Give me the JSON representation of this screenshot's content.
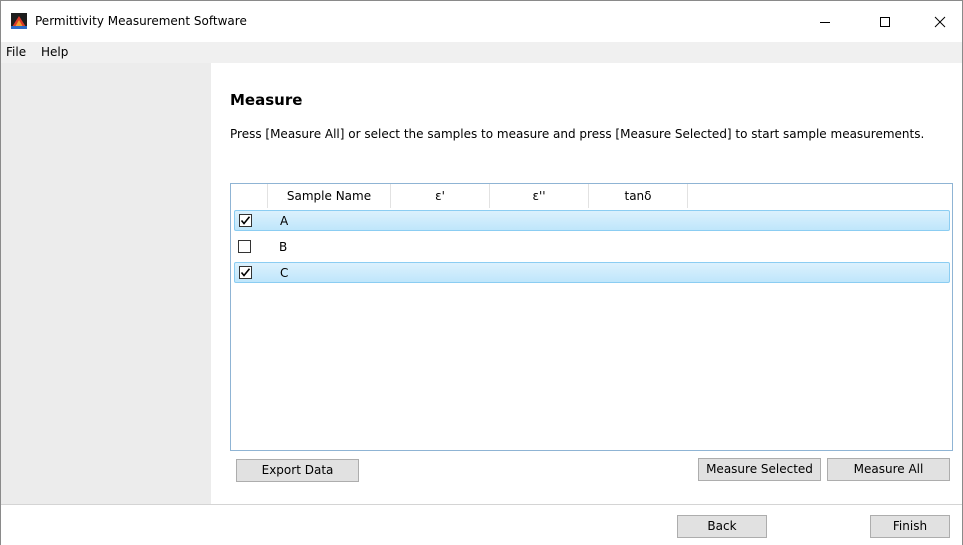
{
  "window": {
    "title": "Permittivity Measurement Software",
    "minimize_glyph": "—",
    "maximize_glyph": "☐",
    "close_glyph": "✕"
  },
  "menu": {
    "file": "File",
    "help": "Help"
  },
  "page": {
    "heading": "Measure",
    "instructions": "Press [Measure All] or select the samples to measure and press [Measure Selected] to start sample measurements."
  },
  "table": {
    "columns": [
      "Sample Name",
      "ε'",
      "ε''",
      "tanδ"
    ],
    "rows": [
      {
        "name": "A",
        "checked": true,
        "selected": true
      },
      {
        "name": "B",
        "checked": false,
        "selected": false
      },
      {
        "name": "C",
        "checked": true,
        "selected": true
      }
    ]
  },
  "buttons": {
    "export": "Export Data",
    "measure_selected": "Measure Selected",
    "measure_all": "Measure All",
    "back": "Back",
    "finish": "Finish"
  },
  "colors": {
    "row_selected": "#cce8f9",
    "sidebar": "#ececec",
    "menubar": "#f0f0f0"
  },
  "icons": {
    "app": "app-icon",
    "checkbox": "checkmark-icon"
  }
}
